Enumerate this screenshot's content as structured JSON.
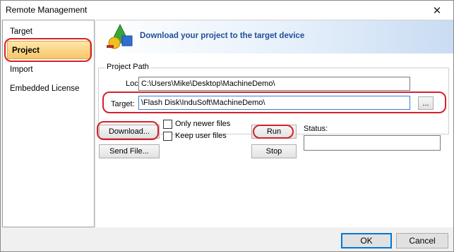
{
  "window": {
    "title": "Remote Management",
    "close_glyph": "✕"
  },
  "nav": {
    "items": [
      {
        "label": "Target",
        "selected": false
      },
      {
        "label": "Project",
        "selected": true
      },
      {
        "label": "Import",
        "selected": false
      },
      {
        "label": "Embedded License",
        "selected": false
      }
    ]
  },
  "banner": {
    "text": "Download your project to the target device",
    "icon": "project-shapes-icon"
  },
  "project_path": {
    "group_label": "Project Path",
    "local_label": "Local:",
    "local_value": "C:\\Users\\Mike\\Desktop\\MachineDemo\\",
    "target_label": "Target:",
    "target_value": "\\Flash Disk\\InduSoft\\MachineDemo\\",
    "browse_label": "..."
  },
  "actions": {
    "download_label": "Download...",
    "send_file_label": "Send File...",
    "only_newer_label": "Only newer files",
    "only_newer_checked": false,
    "keep_user_label": "Keep user files",
    "keep_user_checked": false,
    "run_label": "Run",
    "stop_label": "Stop",
    "status_label": "Status:",
    "status_value": ""
  },
  "footer": {
    "ok_label": "OK",
    "cancel_label": "Cancel"
  },
  "colors": {
    "highlight": "#d6202a",
    "banner_text": "#1f4e96",
    "selection": "#f8c56a"
  }
}
